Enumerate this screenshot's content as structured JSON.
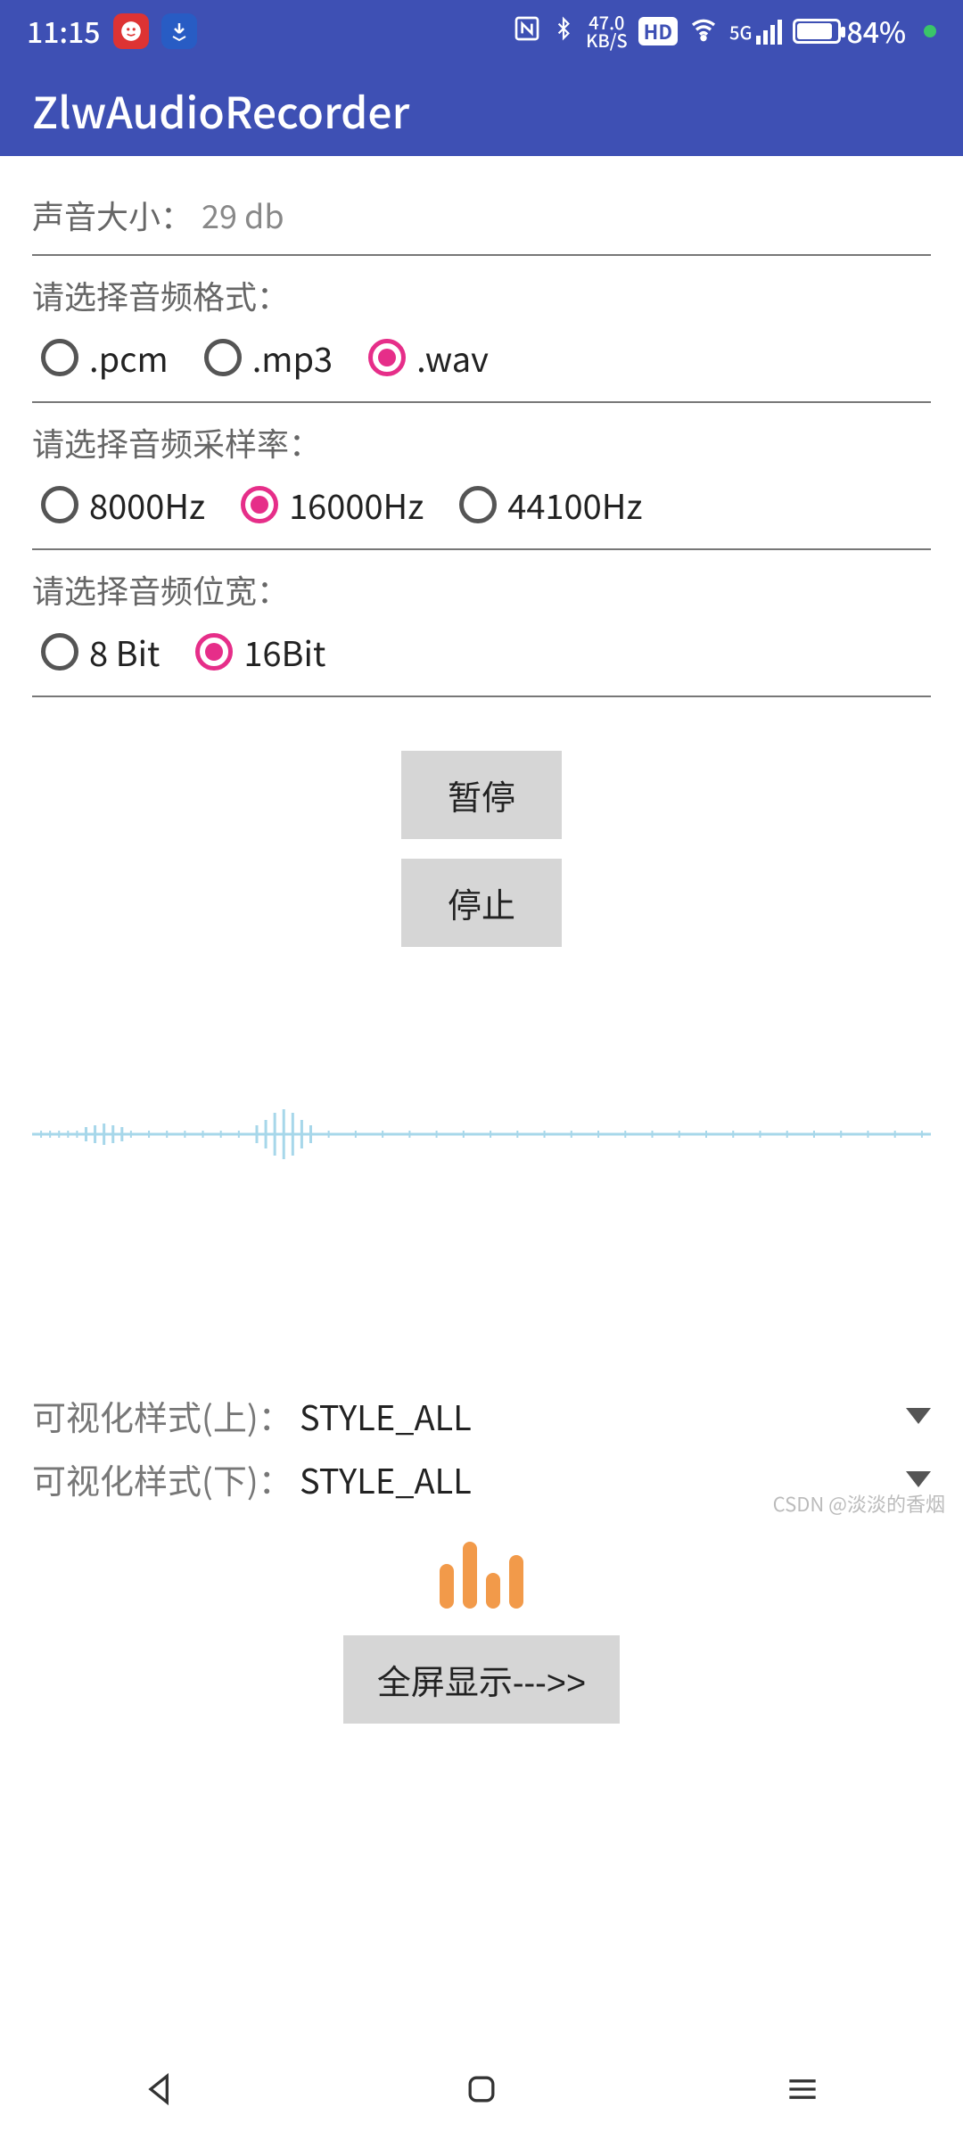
{
  "status": {
    "time": "11:15",
    "net_speed_top": "47.0",
    "net_speed_bottom": "KB/S",
    "hd": "HD",
    "signal": "5G",
    "battery": "84%"
  },
  "app": {
    "title": "ZlwAudioRecorder"
  },
  "volume": {
    "label": "声音大小：",
    "value": "29 db"
  },
  "format": {
    "label": "请选择音频格式：",
    "options": [
      ".pcm",
      ".mp3",
      ".wav"
    ],
    "selected": 2
  },
  "sample_rate": {
    "label": "请选择音频采样率：",
    "options": [
      "8000Hz",
      "16000Hz",
      "44100Hz"
    ],
    "selected": 1
  },
  "bit_width": {
    "label": "请选择音频位宽：",
    "options": [
      "8 Bit",
      "16Bit"
    ],
    "selected": 1
  },
  "buttons": {
    "pause": "暂停",
    "stop": "停止",
    "fullscreen": "全屏显示--->>"
  },
  "style_top": {
    "label": "可视化样式(上)：",
    "value": "STYLE_ALL"
  },
  "style_bottom": {
    "label": "可视化样式(下)：",
    "value": "STYLE_ALL"
  },
  "watermark": "CSDN @淡淡的香烟"
}
